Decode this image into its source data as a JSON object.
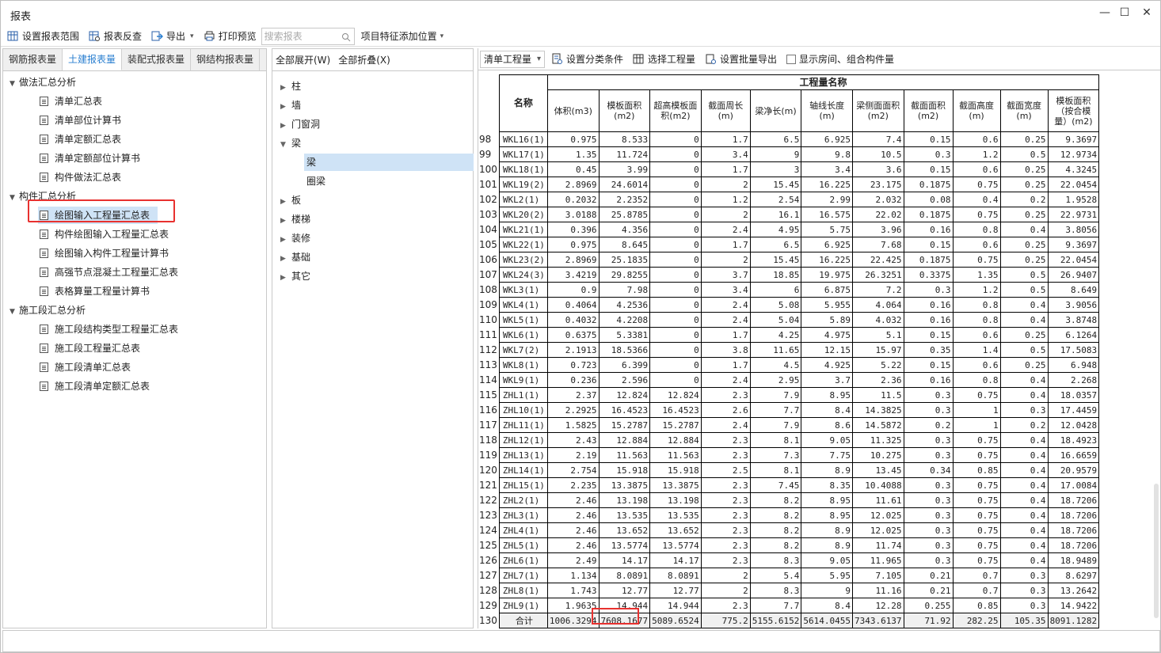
{
  "window": {
    "title": "报表"
  },
  "toolbar": {
    "set_range": "设置报表范围",
    "reverse_check": "报表反查",
    "export": "导出",
    "print_preview": "打印预览",
    "search_placeholder": "搜索报表",
    "item_feature": "项目特征添加位置"
  },
  "left": {
    "tabs": [
      "钢筋报表量",
      "土建报表量",
      "装配式报表量",
      "钢结构报表量"
    ],
    "active_tab": "土建报表量",
    "groups": [
      {
        "label": "做法汇总分析",
        "items": [
          "清单汇总表",
          "清单部位计算书",
          "清单定额汇总表",
          "清单定额部位计算书",
          "构件做法汇总表"
        ]
      },
      {
        "label": "构件汇总分析",
        "items": [
          "绘图输入工程量汇总表",
          "构件绘图输入工程量汇总表",
          "绘图输入构件工程量计算书",
          "高强节点混凝土工程量汇总表",
          "表格算量工程量计算书"
        ]
      },
      {
        "label": "施工段汇总分析",
        "items": [
          "施工段结构类型工程量汇总表",
          "施工段工程量汇总表",
          "施工段清单汇总表",
          "施工段清单定额汇总表"
        ]
      }
    ],
    "selected_item": "绘图输入工程量汇总表"
  },
  "middle": {
    "expand_all": "全部展开(W)",
    "collapse_all": "全部折叠(X)",
    "tree": [
      "柱",
      "墙",
      "门窗洞",
      "梁",
      "梁",
      "圈梁",
      "板",
      "楼梯",
      "装修",
      "基础",
      "其它"
    ],
    "selected": "梁"
  },
  "right": {
    "combo_value": "清单工程量",
    "set_category": "设置分类条件",
    "select_quantity": "选择工程量",
    "set_batch_export": "设置批量导出",
    "show_rooms": "显示房间、组合构件量",
    "header_group": "工程量名称",
    "col_name": "名称",
    "columns": [
      "体积(m3)",
      "模板面积(m2)",
      "超高模板面积(m2)",
      "截面周长(m)",
      "梁净长(m)",
      "轴线长度(m)",
      "梁侧面面积(m2)",
      "截面面积(m2)",
      "截面高度(m)",
      "截面宽度(m)",
      "模板面积（按合模量）(m2)"
    ],
    "rows": [
      [
        "98",
        "WKL16(1)",
        "0.975",
        "8.533",
        "0",
        "1.7",
        "6.5",
        "6.925",
        "7.4",
        "0.15",
        "0.6",
        "0.25",
        "9.3697"
      ],
      [
        "99",
        "WKL17(1)",
        "1.35",
        "11.724",
        "0",
        "3.4",
        "9",
        "9.8",
        "10.5",
        "0.3",
        "1.2",
        "0.5",
        "12.9734"
      ],
      [
        "100",
        "WKL18(1)",
        "0.45",
        "3.99",
        "0",
        "1.7",
        "3",
        "3.4",
        "3.6",
        "0.15",
        "0.6",
        "0.25",
        "4.3245"
      ],
      [
        "101",
        "WKL19(2)",
        "2.8969",
        "24.6014",
        "0",
        "2",
        "15.45",
        "16.225",
        "23.175",
        "0.1875",
        "0.75",
        "0.25",
        "22.0454"
      ],
      [
        "102",
        "WKL2(1)",
        "0.2032",
        "2.2352",
        "0",
        "1.2",
        "2.54",
        "2.99",
        "2.032",
        "0.08",
        "0.4",
        "0.2",
        "1.9528"
      ],
      [
        "103",
        "WKL20(2)",
        "3.0188",
        "25.8785",
        "0",
        "2",
        "16.1",
        "16.575",
        "22.02",
        "0.1875",
        "0.75",
        "0.25",
        "22.9731"
      ],
      [
        "104",
        "WKL21(1)",
        "0.396",
        "4.356",
        "0",
        "2.4",
        "4.95",
        "5.75",
        "3.96",
        "0.16",
        "0.8",
        "0.4",
        "3.8056"
      ],
      [
        "105",
        "WKL22(1)",
        "0.975",
        "8.645",
        "0",
        "1.7",
        "6.5",
        "6.925",
        "7.68",
        "0.15",
        "0.6",
        "0.25",
        "9.3697"
      ],
      [
        "106",
        "WKL23(2)",
        "2.8969",
        "25.1835",
        "0",
        "2",
        "15.45",
        "16.225",
        "22.425",
        "0.1875",
        "0.75",
        "0.25",
        "22.0454"
      ],
      [
        "107",
        "WKL24(3)",
        "3.4219",
        "29.8255",
        "0",
        "3.7",
        "18.85",
        "19.975",
        "26.3251",
        "0.3375",
        "1.35",
        "0.5",
        "26.9407"
      ],
      [
        "108",
        "WKL3(1)",
        "0.9",
        "7.98",
        "0",
        "3.4",
        "6",
        "6.875",
        "7.2",
        "0.3",
        "1.2",
        "0.5",
        "8.649"
      ],
      [
        "109",
        "WKL4(1)",
        "0.4064",
        "4.2536",
        "0",
        "2.4",
        "5.08",
        "5.955",
        "4.064",
        "0.16",
        "0.8",
        "0.4",
        "3.9056"
      ],
      [
        "110",
        "WKL5(1)",
        "0.4032",
        "4.2208",
        "0",
        "2.4",
        "5.04",
        "5.89",
        "4.032",
        "0.16",
        "0.8",
        "0.4",
        "3.8748"
      ],
      [
        "111",
        "WKL6(1)",
        "0.6375",
        "5.3381",
        "0",
        "1.7",
        "4.25",
        "4.975",
        "5.1",
        "0.15",
        "0.6",
        "0.25",
        "6.1264"
      ],
      [
        "112",
        "WKL7(2)",
        "2.1913",
        "18.5366",
        "0",
        "3.8",
        "11.65",
        "12.15",
        "15.97",
        "0.35",
        "1.4",
        "0.5",
        "17.5083"
      ],
      [
        "113",
        "WKL8(1)",
        "0.723",
        "6.399",
        "0",
        "1.7",
        "4.5",
        "4.925",
        "5.22",
        "0.15",
        "0.6",
        "0.25",
        "6.948"
      ],
      [
        "114",
        "WKL9(1)",
        "0.236",
        "2.596",
        "0",
        "2.4",
        "2.95",
        "3.7",
        "2.36",
        "0.16",
        "0.8",
        "0.4",
        "2.268"
      ],
      [
        "115",
        "ZHL1(1)",
        "2.37",
        "12.824",
        "12.824",
        "2.3",
        "7.9",
        "8.95",
        "11.5",
        "0.3",
        "0.75",
        "0.4",
        "18.0357"
      ],
      [
        "116",
        "ZHL10(1)",
        "2.2925",
        "16.4523",
        "16.4523",
        "2.6",
        "7.7",
        "8.4",
        "14.3825",
        "0.3",
        "1",
        "0.3",
        "17.4459"
      ],
      [
        "117",
        "ZHL11(1)",
        "1.5825",
        "15.2787",
        "15.2787",
        "2.4",
        "7.9",
        "8.6",
        "14.5872",
        "0.2",
        "1",
        "0.2",
        "12.0428"
      ],
      [
        "118",
        "ZHL12(1)",
        "2.43",
        "12.884",
        "12.884",
        "2.3",
        "8.1",
        "9.05",
        "11.325",
        "0.3",
        "0.75",
        "0.4",
        "18.4923"
      ],
      [
        "119",
        "ZHL13(1)",
        "2.19",
        "11.563",
        "11.563",
        "2.3",
        "7.3",
        "7.75",
        "10.275",
        "0.3",
        "0.75",
        "0.4",
        "16.6659"
      ],
      [
        "120",
        "ZHL14(1)",
        "2.754",
        "15.918",
        "15.918",
        "2.5",
        "8.1",
        "8.9",
        "13.45",
        "0.34",
        "0.85",
        "0.4",
        "20.9579"
      ],
      [
        "121",
        "ZHL15(1)",
        "2.235",
        "13.3875",
        "13.3875",
        "2.3",
        "7.45",
        "8.35",
        "10.4088",
        "0.3",
        "0.75",
        "0.4",
        "17.0084"
      ],
      [
        "122",
        "ZHL2(1)",
        "2.46",
        "13.198",
        "13.198",
        "2.3",
        "8.2",
        "8.95",
        "11.61",
        "0.3",
        "0.75",
        "0.4",
        "18.7206"
      ],
      [
        "123",
        "ZHL3(1)",
        "2.46",
        "13.535",
        "13.535",
        "2.3",
        "8.2",
        "8.95",
        "12.025",
        "0.3",
        "0.75",
        "0.4",
        "18.7206"
      ],
      [
        "124",
        "ZHL4(1)",
        "2.46",
        "13.652",
        "13.652",
        "2.3",
        "8.2",
        "8.9",
        "12.025",
        "0.3",
        "0.75",
        "0.4",
        "18.7206"
      ],
      [
        "125",
        "ZHL5(1)",
        "2.46",
        "13.5774",
        "13.5774",
        "2.3",
        "8.2",
        "8.9",
        "11.74",
        "0.3",
        "0.75",
        "0.4",
        "18.7206"
      ],
      [
        "126",
        "ZHL6(1)",
        "2.49",
        "14.17",
        "14.17",
        "2.3",
        "8.3",
        "9.05",
        "11.965",
        "0.3",
        "0.75",
        "0.4",
        "18.9489"
      ],
      [
        "127",
        "ZHL7(1)",
        "1.134",
        "8.0891",
        "8.0891",
        "2",
        "5.4",
        "5.95",
        "7.105",
        "0.21",
        "0.7",
        "0.3",
        "8.6297"
      ],
      [
        "128",
        "ZHL8(1)",
        "1.743",
        "12.77",
        "12.77",
        "2",
        "8.3",
        "9",
        "11.16",
        "0.21",
        "0.7",
        "0.3",
        "13.2642"
      ],
      [
        "129",
        "ZHL9(1)",
        "1.9635",
        "14.944",
        "14.944",
        "2.3",
        "7.7",
        "8.4",
        "12.28",
        "0.255",
        "0.85",
        "0.3",
        "14.9422"
      ]
    ],
    "total": [
      "130",
      "合计",
      "1006.3294",
      "7608.1677",
      "5089.6524",
      "775.2",
      "5155.6152",
      "5614.0455",
      "7343.6137",
      "71.92",
      "282.25",
      "105.35",
      "8091.1282"
    ]
  }
}
